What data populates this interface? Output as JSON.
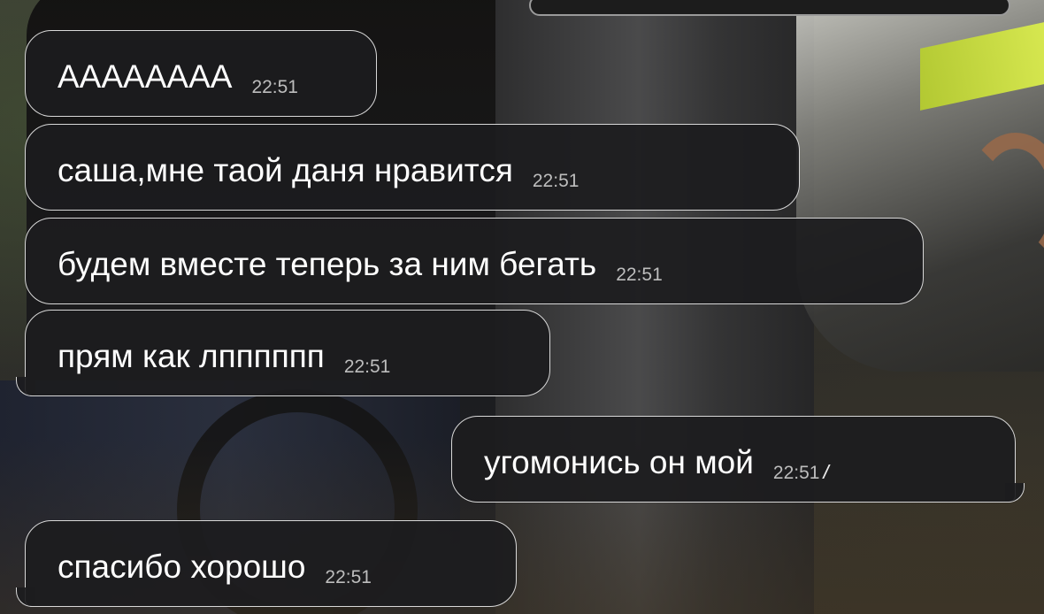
{
  "chat": {
    "messages": [
      {
        "text": "АААААААА",
        "time": "22:51",
        "direction": "incoming"
      },
      {
        "text": "саша,мне таой даня нравится",
        "time": "22:51",
        "direction": "incoming"
      },
      {
        "text": "будем вместе теперь за ним бегать",
        "time": "22:51",
        "direction": "incoming"
      },
      {
        "text": "прям как лпппппп",
        "time": "22:51",
        "direction": "incoming"
      },
      {
        "text": "угомонись он мой",
        "time": "22:51",
        "direction": "outgoing",
        "status": "read-double-check-icon"
      },
      {
        "text": "спасибо хорошо",
        "time": "22:51",
        "direction": "incoming"
      }
    ]
  },
  "colors": {
    "bubble_bg": "#1c1c1e",
    "bubble_border": "#d8d8d8",
    "text": "#ffffff",
    "time": "#bdbdbd"
  }
}
